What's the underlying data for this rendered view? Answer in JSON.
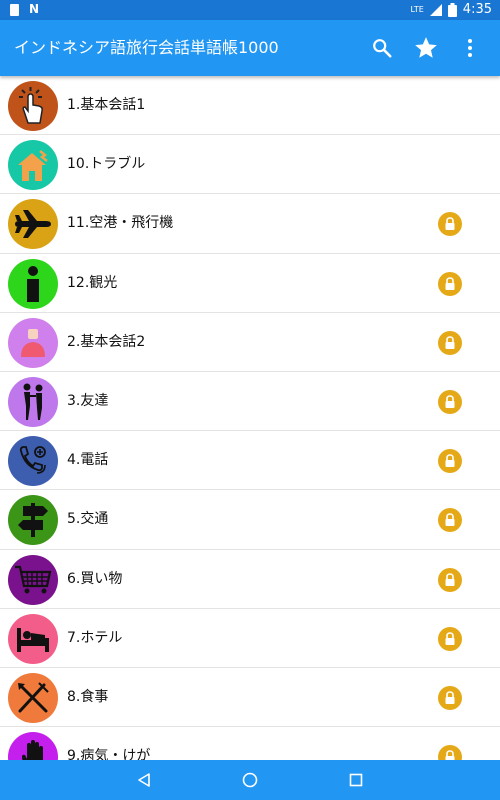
{
  "status_bar": {
    "network": "LTE",
    "time": "4:35"
  },
  "app_bar": {
    "title": "インドネシア語旅行会話単語帳1000",
    "icons": [
      "search-icon",
      "star-icon",
      "more-vert-icon"
    ]
  },
  "colors": {
    "status_bar": "#1976d2",
    "app_bar": "#2196f3",
    "lock": "#e5a917"
  },
  "items": [
    {
      "label": "1.基本会話1",
      "icon": "tap-hand-icon",
      "color": "#c0531a",
      "locked": false
    },
    {
      "label": "10.トラブル",
      "icon": "broken-house-icon",
      "color": "#17c8a7",
      "locked": false
    },
    {
      "label": "11.空港・飛行機",
      "icon": "airplane-icon",
      "color": "#daa316",
      "locked": true
    },
    {
      "label": "12.観光",
      "icon": "info-icon",
      "color": "#2ed61b",
      "locked": true
    },
    {
      "label": "2.基本会話2",
      "icon": "person-icon",
      "color": "#d080ec",
      "locked": true
    },
    {
      "label": "3.友達",
      "icon": "friends-icon",
      "color": "#bf78ec",
      "locked": true
    },
    {
      "label": "4.電話",
      "icon": "phone-icon",
      "color": "#3d5dae",
      "locked": true
    },
    {
      "label": "5.交通",
      "icon": "signpost-icon",
      "color": "#3b9617",
      "locked": true
    },
    {
      "label": "6.買い物",
      "icon": "cart-icon",
      "color": "#7a128d",
      "locked": true
    },
    {
      "label": "7.ホテル",
      "icon": "bed-icon",
      "color": "#f35d8a",
      "locked": true
    },
    {
      "label": "8.食事",
      "icon": "fork-knife-icon",
      "color": "#ef7a3b",
      "locked": true
    },
    {
      "label": "9.病気・けが",
      "icon": "hand-icon",
      "color": "#c51fee",
      "locked": true
    }
  ],
  "nav_bar": {
    "buttons": [
      "back-icon",
      "home-icon",
      "recents-icon"
    ]
  }
}
